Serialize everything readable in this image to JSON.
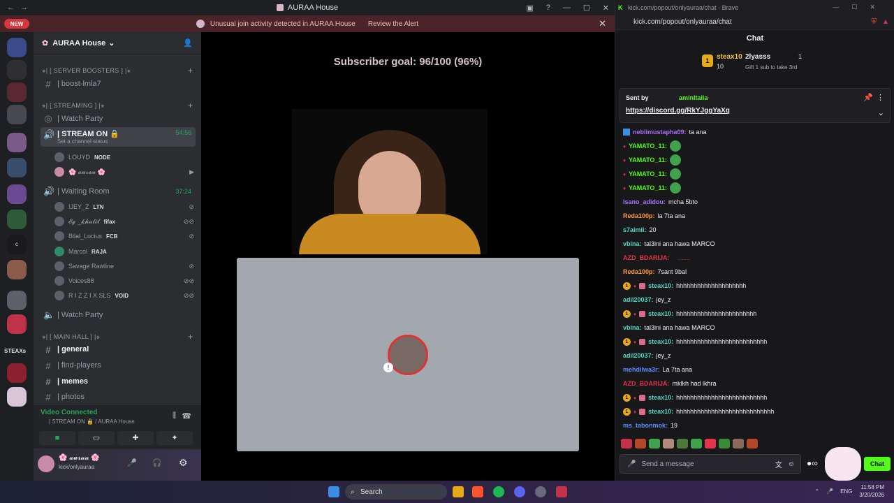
{
  "discord": {
    "window_title": "AURAA House",
    "alert": {
      "text": "Unusual join activity detected in AURAA House",
      "action": "Review the Alert"
    },
    "new_badge": "NEW",
    "server_name": "AURAA House",
    "categories": {
      "boosters": "⚹| [ SERVER BOOSTERS ] |⚹",
      "streaming": "⚹| [ STREAMING ] |⚹",
      "main_hall": "⚹| [ MAIN HALL ] |⚹"
    },
    "channels": {
      "boost": "| boost-lmla7",
      "watch_party_1": "| Watch Party",
      "stream_on": "| STREAM ON 🔒",
      "stream_status": "Set a channel status",
      "stream_time": "54:56",
      "waiting_room": "| Waiting Room",
      "waiting_time": "37:24",
      "watch_party_2": "| Watch Party",
      "general": "| general",
      "find_players": "| find-players",
      "memes": "| memes",
      "photos": "| photos"
    },
    "stream_users": [
      {
        "name": "LOUYD",
        "tag": "NODE"
      },
      {
        "name": "🌸 𝓪𝓾𝓻𝓪𝓪 🌸",
        "tag": ""
      }
    ],
    "waiting_users": [
      {
        "name": "!JEY_Z",
        "tag": "LTN"
      },
      {
        "name": "𝓔𝓰 _𝓴𝓱𝓪𝓵𝓲𝓵",
        "tag": "fifax"
      },
      {
        "name": "Bilal_Lucius",
        "tag": "FCB"
      },
      {
        "name": "Marcol",
        "tag": "RAJA"
      },
      {
        "name": "Savage Rawline",
        "tag": ""
      },
      {
        "name": "Voices88",
        "tag": ""
      },
      {
        "name": "R I Z Z I X SLS",
        "tag": "VOID"
      }
    ],
    "server_label": "STEAXs",
    "voice": {
      "status": "Video Connected",
      "location": "| STREAM ON 🔒 / AURAA House"
    },
    "me": {
      "name": "🌸 𝓪𝓾𝓻𝓪𝓪 🌸",
      "sub": "kick/onlyauraa"
    },
    "subscriber_goal": "Subscriber goal: 96/100 (96%)"
  },
  "browser": {
    "title": "kick.com/popout/onlyauraa/chat - Brave",
    "url": "kick.com/popout/onlyauraa/chat",
    "chat_header": "Chat",
    "leader1": {
      "rank": "1",
      "name": "steax10",
      "count": "10"
    },
    "leader2": {
      "name": "2lyasss",
      "count": "1",
      "hint": "Gift 1 sub to take 3rd"
    },
    "pinned": {
      "sent_by": "Sent by",
      "user": "aminItalia",
      "link": "https://discord.gg/RkYJggYaXq"
    },
    "messages": [
      {
        "user": "neblimustapha09",
        "color": "#a970ff",
        "text": "ta ana",
        "badges": "blue"
      },
      {
        "user": "YAMATO_11",
        "color": "#53fc18",
        "text": "",
        "badges": "red",
        "emote": true
      },
      {
        "user": "YAMATO_11",
        "color": "#53fc18",
        "text": "",
        "badges": "red",
        "emote": true
      },
      {
        "user": "YAMATO_11",
        "color": "#53fc18",
        "text": "",
        "badges": "red",
        "emote": true
      },
      {
        "user": "YAMATO_11",
        "color": "#53fc18",
        "text": "",
        "badges": "red",
        "emote": true
      },
      {
        "user": "Isano_adidou",
        "color": "#a970ff",
        "text": "mcha 5bto",
        "badges": ""
      },
      {
        "user": "Reda100p",
        "color": "#ff9d3c",
        "text": "la 7ta ana",
        "badges": ""
      },
      {
        "user": "s7aimii",
        "color": "#56d6c2",
        "text": "20",
        "badges": ""
      },
      {
        "user": "vbina",
        "color": "#56d6c2",
        "text": "tal3ini ana hawa MARCO",
        "badges": ""
      },
      {
        "user": "AZD_BDARIJA",
        "color": "#e5334b",
        "text": "",
        "badges": "",
        "dots": true
      },
      {
        "user": "Reda100p",
        "color": "#ff9d3c",
        "text": "7sant 9bal",
        "badges": ""
      },
      {
        "user": "steax10",
        "color": "#56d6c2",
        "text": "hhhhhhhhhhhhhhhhhhhh",
        "badges": "gold"
      },
      {
        "user": "adil20037",
        "color": "#56d6c2",
        "text": "jey_z",
        "badges": ""
      },
      {
        "user": "steax10",
        "color": "#56d6c2",
        "text": "hhhhhhhhhhhhhhhhhhhhhhh",
        "badges": "gold"
      },
      {
        "user": "vbina",
        "color": "#56d6c2",
        "text": "tal3ini ana hawa MARCO",
        "badges": ""
      },
      {
        "user": "steax10",
        "color": "#56d6c2",
        "text": "hhhhhhhhhhhhhhhhhhhhhhhhhh",
        "badges": "gold"
      },
      {
        "user": "adil20037",
        "color": "#56d6c2",
        "text": "jey_z",
        "badges": ""
      },
      {
        "user": "mehdilwa3r",
        "color": "#5b8cff",
        "text": "La 7ta ana",
        "badges": ""
      },
      {
        "user": "AZD_BDARIJA",
        "color": "#e5334b",
        "text": "mklkh had lkhra",
        "badges": ""
      },
      {
        "user": "steax10",
        "color": "#56d6c2",
        "text": "hhhhhhhhhhhhhhhhhhhhhhhhhh",
        "badges": "gold"
      },
      {
        "user": "steax10",
        "color": "#56d6c2",
        "text": "hhhhhhhhhhhhhhhhhhhhhhhhhhhh",
        "badges": "gold"
      },
      {
        "user": "ms_tabonmok",
        "color": "#5b8cff",
        "text": "19",
        "badges": ""
      }
    ],
    "send_placeholder": "Send a message",
    "chat_button": "Chat"
  },
  "taskbar": {
    "search": "Search",
    "lang": "ENG",
    "time": "11:58 PM",
    "date": "3/20/2026"
  }
}
